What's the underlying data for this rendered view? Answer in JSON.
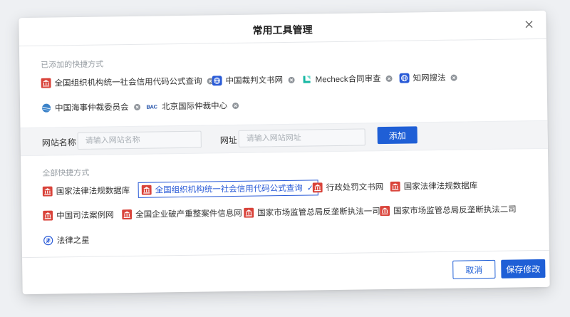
{
  "dialog": {
    "title": "常用工具管理"
  },
  "added": {
    "label": "已添加的快捷方式",
    "items": [
      {
        "label": "全国组织机构统一社会信用代码公式查询",
        "icon": "bank-icon"
      },
      {
        "label": "中国裁判文书网",
        "icon": "globe-icon"
      },
      {
        "label": "Mecheck合同审查",
        "icon": "mecheck-logo-icon"
      },
      {
        "label": "知网搜法",
        "icon": "globe-icon"
      },
      {
        "label": "中国海事仲裁委员会",
        "icon": "earth-icon"
      },
      {
        "label": "北京国际仲裁中心",
        "icon": "bac-logo-icon",
        "logo_text": "BAC"
      }
    ]
  },
  "form": {
    "name_label": "网站名称",
    "name_placeholder": "请输入网站名称",
    "url_label": "网址",
    "url_placeholder": "请输入网站网址",
    "add_label": "添加"
  },
  "all": {
    "label": "全部快捷方式",
    "items": [
      {
        "label": "国家法律法规数据库",
        "icon": "bank-icon"
      },
      {
        "label": "全国组织机构统一社会信用代码公式查询",
        "icon": "bank-icon",
        "selected": true
      },
      {
        "label": "行政处罚文书网",
        "icon": "bank-icon"
      },
      {
        "label": "国家法律法规数据库",
        "icon": "bank-icon"
      },
      {
        "label": "中国司法案例网",
        "icon": "bank-icon"
      },
      {
        "label": "全国企业破产重整案件信息网",
        "icon": "bank-icon"
      },
      {
        "label": "国家市场监管总局反垄断执法一司",
        "icon": "bank-icon"
      },
      {
        "label": "国家市场监管总局反垄断执法二司",
        "icon": "bank-icon"
      },
      {
        "label": "法律之星",
        "icon": "law-star-icon"
      }
    ]
  },
  "footer": {
    "cancel_label": "取消",
    "save_label": "保存修改"
  },
  "colors": {
    "primary": "#1f5fd6",
    "bank_icon": "#d9433a",
    "globe_icon": "#2a5bd7",
    "mecheck_icon": "#19b8a4"
  }
}
